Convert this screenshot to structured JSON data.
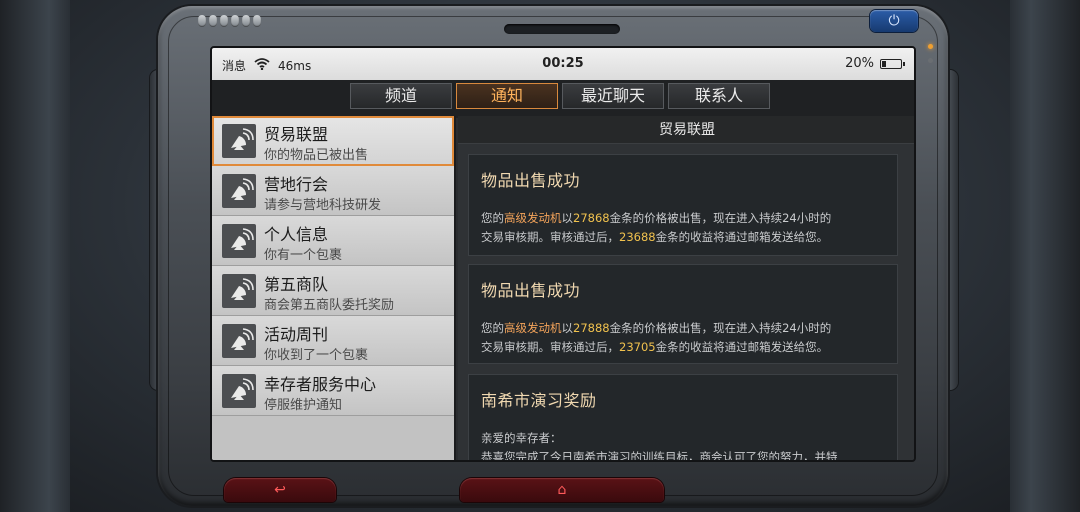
{
  "statusbar": {
    "left_label": "消息",
    "network": "46ms",
    "time": "00:25",
    "battery": "20%",
    "battery_level": 0.2
  },
  "tabs": [
    {
      "label": "频道",
      "active": false
    },
    {
      "label": "通知",
      "active": true
    },
    {
      "label": "最近聊天",
      "active": false
    },
    {
      "label": "联系人",
      "active": false
    }
  ],
  "sidebar": {
    "items": [
      {
        "title": "贸易联盟",
        "subtitle": "你的物品已被出售",
        "icon": "satellite-dish-icon",
        "active": true
      },
      {
        "title": "营地行会",
        "subtitle": "请参与营地科技研发",
        "icon": "satellite-dish-icon",
        "active": false
      },
      {
        "title": "个人信息",
        "subtitle": "你有一个包裹",
        "icon": "satellite-dish-icon",
        "active": false
      },
      {
        "title": "第五商队",
        "subtitle": "商会第五商队委托奖励",
        "icon": "satellite-dish-icon",
        "active": false
      },
      {
        "title": "活动周刊",
        "subtitle": "你收到了一个包裹",
        "icon": "satellite-dish-icon",
        "active": false
      },
      {
        "title": "幸存者服务中心",
        "subtitle": "停服维护通知",
        "icon": "satellite-dish-icon",
        "active": false
      }
    ]
  },
  "detail": {
    "header": "贸易联盟",
    "messages": [
      {
        "title": "物品出售成功",
        "line1_a": "您的",
        "item": "高级发动机",
        "line1_b": "以",
        "price": "27868",
        "line1_c": "金条的价格被出售，现在进入持续24小时的",
        "line2_a": "交易审核期。审核通过后，",
        "income": "23688",
        "line2_b": "金条的收益将通过邮箱发送给您。"
      },
      {
        "title": "物品出售成功",
        "line1_a": "您的",
        "item": "高级发动机",
        "line1_b": "以",
        "price": "27888",
        "line1_c": "金条的价格被出售，现在进入持续24小时的",
        "line2_a": "交易审核期。审核通过后，",
        "income": "23705",
        "line2_b": "金条的收益将通过邮箱发送给您。"
      },
      {
        "title": "南希市演习奖励",
        "greeting": "亲爱的幸存者：",
        "body": "恭喜您完成了今日南希市演习的训练目标，商会认可了您的努力，并特"
      }
    ]
  },
  "buttons": {
    "back_icon": "↩",
    "home_icon": "⌂"
  },
  "colors": {
    "accent_orange": "#e08a3a",
    "highlight_orange": "#f3a35a",
    "highlight_yellow": "#f1c24e",
    "power_blue": "#2b5da8",
    "button_red": "#ff5a5a"
  }
}
